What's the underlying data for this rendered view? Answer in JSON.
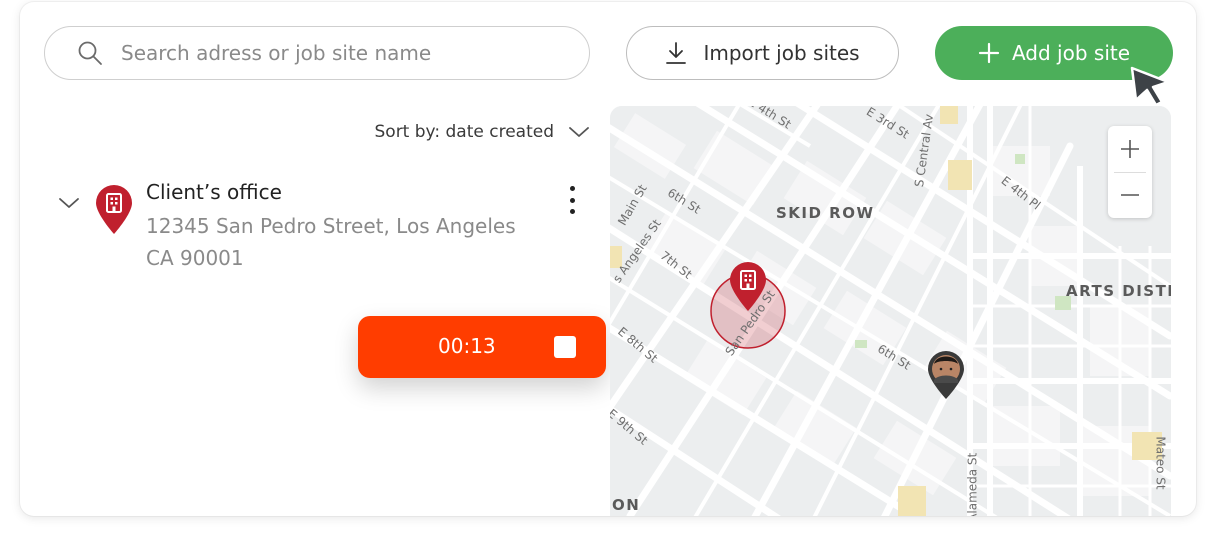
{
  "toolbar": {
    "search_placeholder": "Search adress or job site name",
    "import_label": "Import job sites",
    "add_label": "Add job site"
  },
  "list": {
    "sort_label": "Sort by: date created",
    "items": [
      {
        "name": "Client’s office",
        "address_line1": "12345 San Pedro Street, Los Angeles",
        "address_line2": "CA 90001"
      }
    ]
  },
  "timer": {
    "elapsed": "00:13"
  },
  "map": {
    "labels": {
      "skid_row": "SKID ROW",
      "arts_district": "ARTS DISTR",
      "e_4th_st": "E 4th St",
      "e_3rd_st": "E 3rd St",
      "s_central_av": "S Central Av",
      "e_4th_pl": "E 4th Pl",
      "main_st": "Main St",
      "sixth_st_a": "6th St",
      "los_angeles_st": "s Angeles St",
      "seventh_st": "7th St",
      "san_pedro_st": "San Pedro St",
      "e_8th_st": "E 8th St",
      "sixth_st_b": "6th St",
      "e_9th_st": "E 9th St",
      "alameda_st": "S Alameda St",
      "mateo_st": "Mateo St",
      "bottom_left": "ON"
    },
    "zoom_in": "+",
    "zoom_out": "−"
  },
  "colors": {
    "accent_green": "#4caf5a",
    "timer_red": "#ff3d00",
    "pin_red": "#c0202e"
  },
  "icons": {
    "search": "search-icon",
    "import": "download-icon",
    "add": "plus-icon",
    "sort": "chevron-down-icon",
    "expand": "chevron-down-icon",
    "site": "building-pin-icon",
    "menu": "kebab-icon",
    "stop": "stop-icon"
  }
}
